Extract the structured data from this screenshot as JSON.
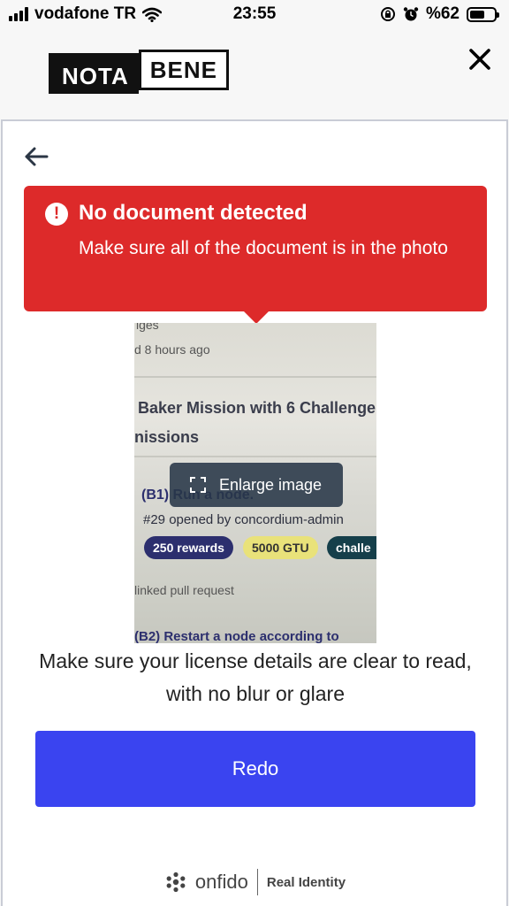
{
  "status_bar": {
    "carrier": "vodafone TR",
    "time": "23:55",
    "battery": "%62",
    "battery_level": 0.62
  },
  "header": {
    "logo_left": "NOTA",
    "logo_right": "BENE",
    "close_icon": "close-icon"
  },
  "alert": {
    "title": "No document detected",
    "message": "Make sure all of the document is in the photo",
    "icon": "exclamation-icon",
    "color": "#dd2a2a"
  },
  "photo": {
    "line1": "iges",
    "line2": "d 8 hours ago",
    "line3": "Baker Mission with 6 Challenge",
    "line4": "nissions",
    "line5": "(B1) Run a node.",
    "line6": "#29 opened by concordium-admin",
    "pill1": "250 rewards",
    "pill2": "5000 GTU",
    "pill3": "challe",
    "line7": "linked pull request",
    "line8": "(B2) Restart a node according to",
    "enlarge_label": "Enlarge image"
  },
  "hint": "Make sure your license details are clear to read, with no blur or glare",
  "redo_label": "Redo",
  "redo_color": "#3a44f0",
  "footer": {
    "brand": "onfido",
    "tagline": "Real Identity"
  }
}
